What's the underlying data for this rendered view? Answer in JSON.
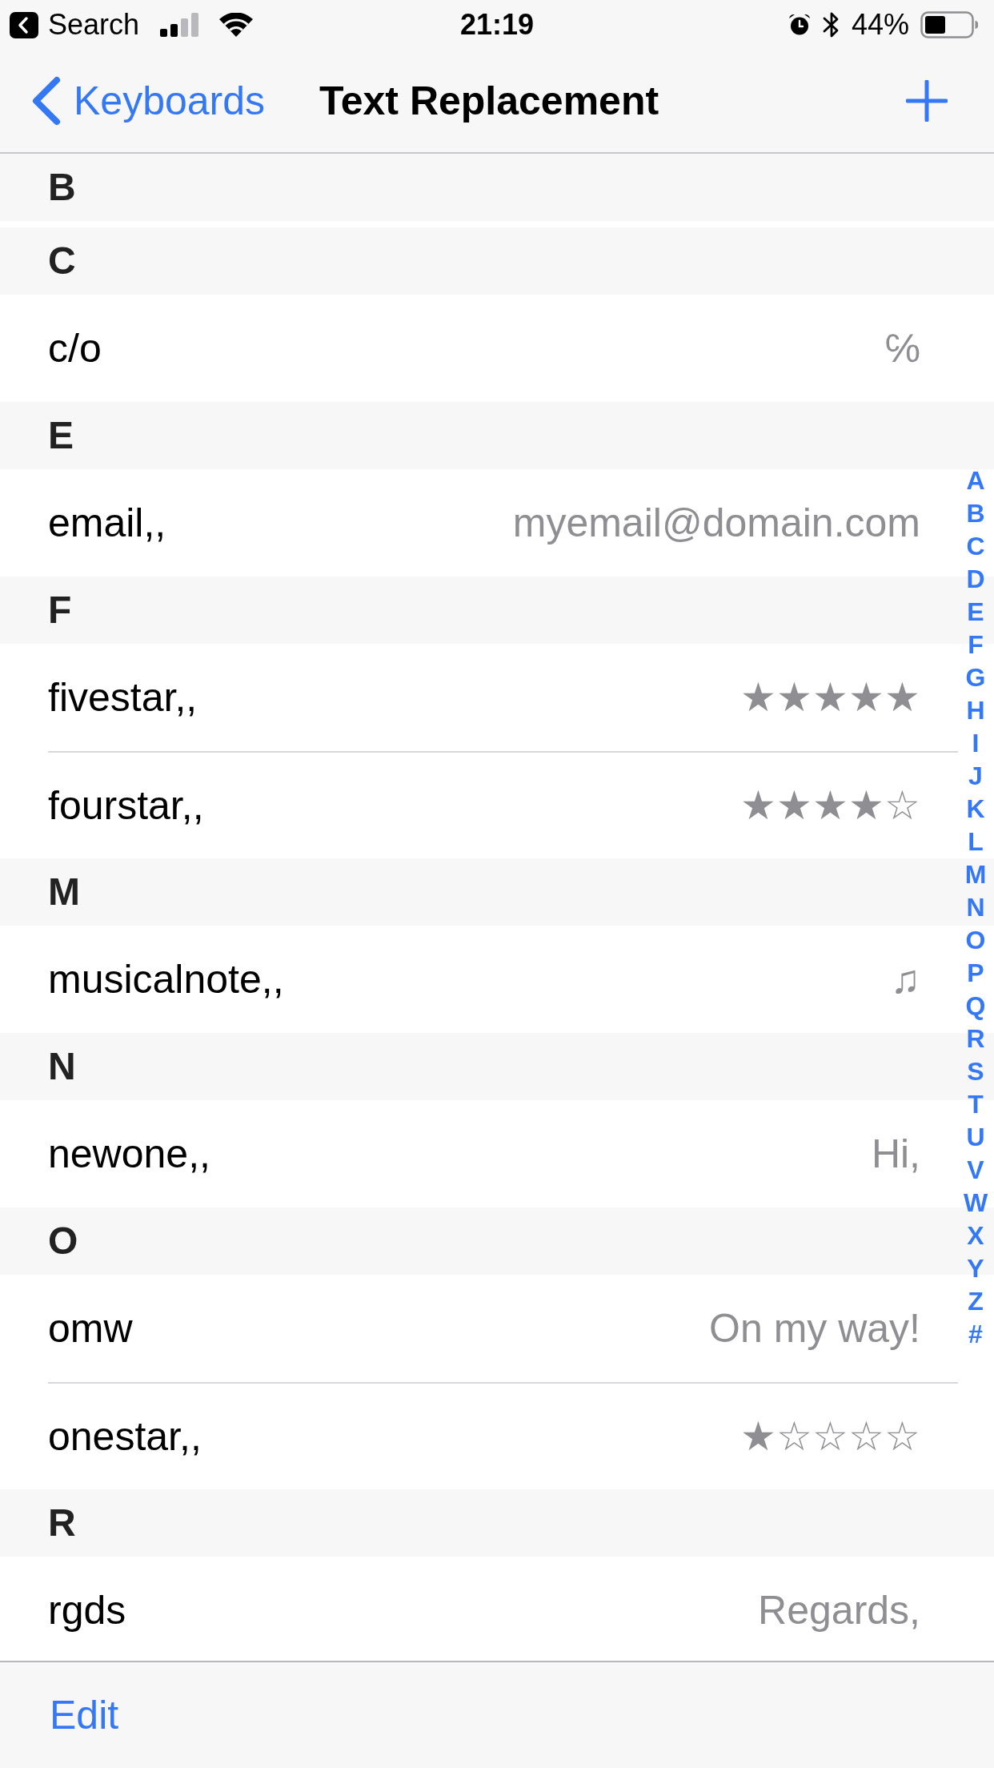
{
  "status_bar": {
    "back_label": "Search",
    "time": "21:19",
    "battery": "44%"
  },
  "nav_bar": {
    "back_label": "Keyboards",
    "title": "Text Replacement"
  },
  "sections": [
    {
      "letter": "B"
    },
    {
      "letter": "C",
      "items": [
        {
          "shortcut": "c/o",
          "phrase": "℅"
        }
      ]
    },
    {
      "letter": "E",
      "items": [
        {
          "shortcut": "email,,",
          "phrase": "myemail@domain.com"
        }
      ]
    },
    {
      "letter": "F",
      "items": [
        {
          "shortcut": "fivestar,,",
          "phrase": "★★★★★"
        },
        {
          "shortcut": "fourstar,,",
          "phrase": "★★★★☆"
        }
      ]
    },
    {
      "letter": "M",
      "items": [
        {
          "shortcut": "musicalnote,,",
          "phrase": "♫"
        }
      ]
    },
    {
      "letter": "N",
      "items": [
        {
          "shortcut": "newone,,",
          "phrase": "Hi,"
        }
      ]
    },
    {
      "letter": "O",
      "items": [
        {
          "shortcut": "omw",
          "phrase": "On my way!"
        },
        {
          "shortcut": "onestar,,",
          "phrase": "★☆☆☆☆"
        }
      ]
    },
    {
      "letter": "R",
      "items": [
        {
          "shortcut": "rgds",
          "phrase": "Regards,"
        }
      ]
    }
  ],
  "section_index": [
    "A",
    "B",
    "C",
    "D",
    "E",
    "F",
    "G",
    "H",
    "I",
    "J",
    "K",
    "L",
    "M",
    "N",
    "O",
    "P",
    "Q",
    "R",
    "S",
    "T",
    "U",
    "V",
    "W",
    "X",
    "Y",
    "Z",
    "#"
  ],
  "toolbar": {
    "edit_label": "Edit"
  }
}
